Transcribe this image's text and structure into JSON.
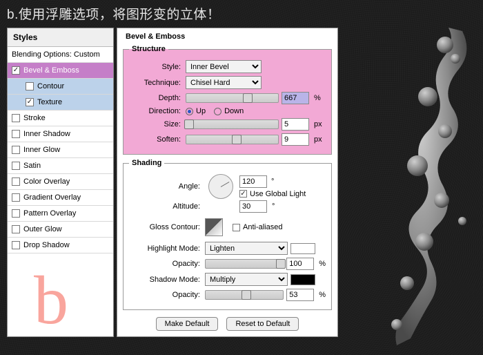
{
  "heading": "b.使用浮雕选项，将图形变的立体！",
  "big_letter": "b",
  "sidebar": {
    "title": "Styles",
    "items": [
      {
        "label": "Blending Options: Custom",
        "checked": null
      },
      {
        "label": "Bevel & Emboss",
        "checked": true,
        "selected": true
      },
      {
        "label": "Contour",
        "checked": false,
        "indent": true,
        "sub": true
      },
      {
        "label": "Texture",
        "checked": true,
        "indent": true,
        "sub": true
      },
      {
        "label": "Stroke",
        "checked": false
      },
      {
        "label": "Inner Shadow",
        "checked": false
      },
      {
        "label": "Inner Glow",
        "checked": false
      },
      {
        "label": "Satin",
        "checked": false
      },
      {
        "label": "Color Overlay",
        "checked": false
      },
      {
        "label": "Gradient Overlay",
        "checked": false
      },
      {
        "label": "Pattern Overlay",
        "checked": false
      },
      {
        "label": "Outer Glow",
        "checked": false
      },
      {
        "label": "Drop Shadow",
        "checked": false
      }
    ]
  },
  "panel_title": "Bevel & Emboss",
  "structure": {
    "legend": "Structure",
    "style_label": "Style:",
    "style_value": "Inner Bevel",
    "technique_label": "Technique:",
    "technique_value": "Chisel Hard",
    "depth_label": "Depth:",
    "depth_value": "667",
    "depth_unit": "%",
    "direction_label": "Direction:",
    "direction_up": "Up",
    "direction_down": "Down",
    "direction_value": "up",
    "size_label": "Size:",
    "size_value": "5",
    "size_unit": "px",
    "soften_label": "Soften:",
    "soften_value": "9",
    "soften_unit": "px"
  },
  "shading": {
    "legend": "Shading",
    "angle_label": "Angle:",
    "angle_value": "120",
    "angle_unit": "°",
    "global_light_label": "Use Global Light",
    "global_light": true,
    "altitude_label": "Altitude:",
    "altitude_value": "30",
    "altitude_unit": "°",
    "gloss_label": "Gloss Contour:",
    "anti_alias_label": "Anti-aliased",
    "anti_alias": false,
    "highlight_mode_label": "Highlight Mode:",
    "highlight_mode_value": "Lighten",
    "highlight_color": "#ffffff",
    "highlight_opacity_label": "Opacity:",
    "highlight_opacity_value": "100",
    "highlight_opacity_unit": "%",
    "shadow_mode_label": "Shadow Mode:",
    "shadow_mode_value": "Multiply",
    "shadow_color": "#000000",
    "shadow_opacity_label": "Opacity:",
    "shadow_opacity_value": "53",
    "shadow_opacity_unit": "%"
  },
  "buttons": {
    "make_default": "Make Default",
    "reset_default": "Reset to Default"
  }
}
